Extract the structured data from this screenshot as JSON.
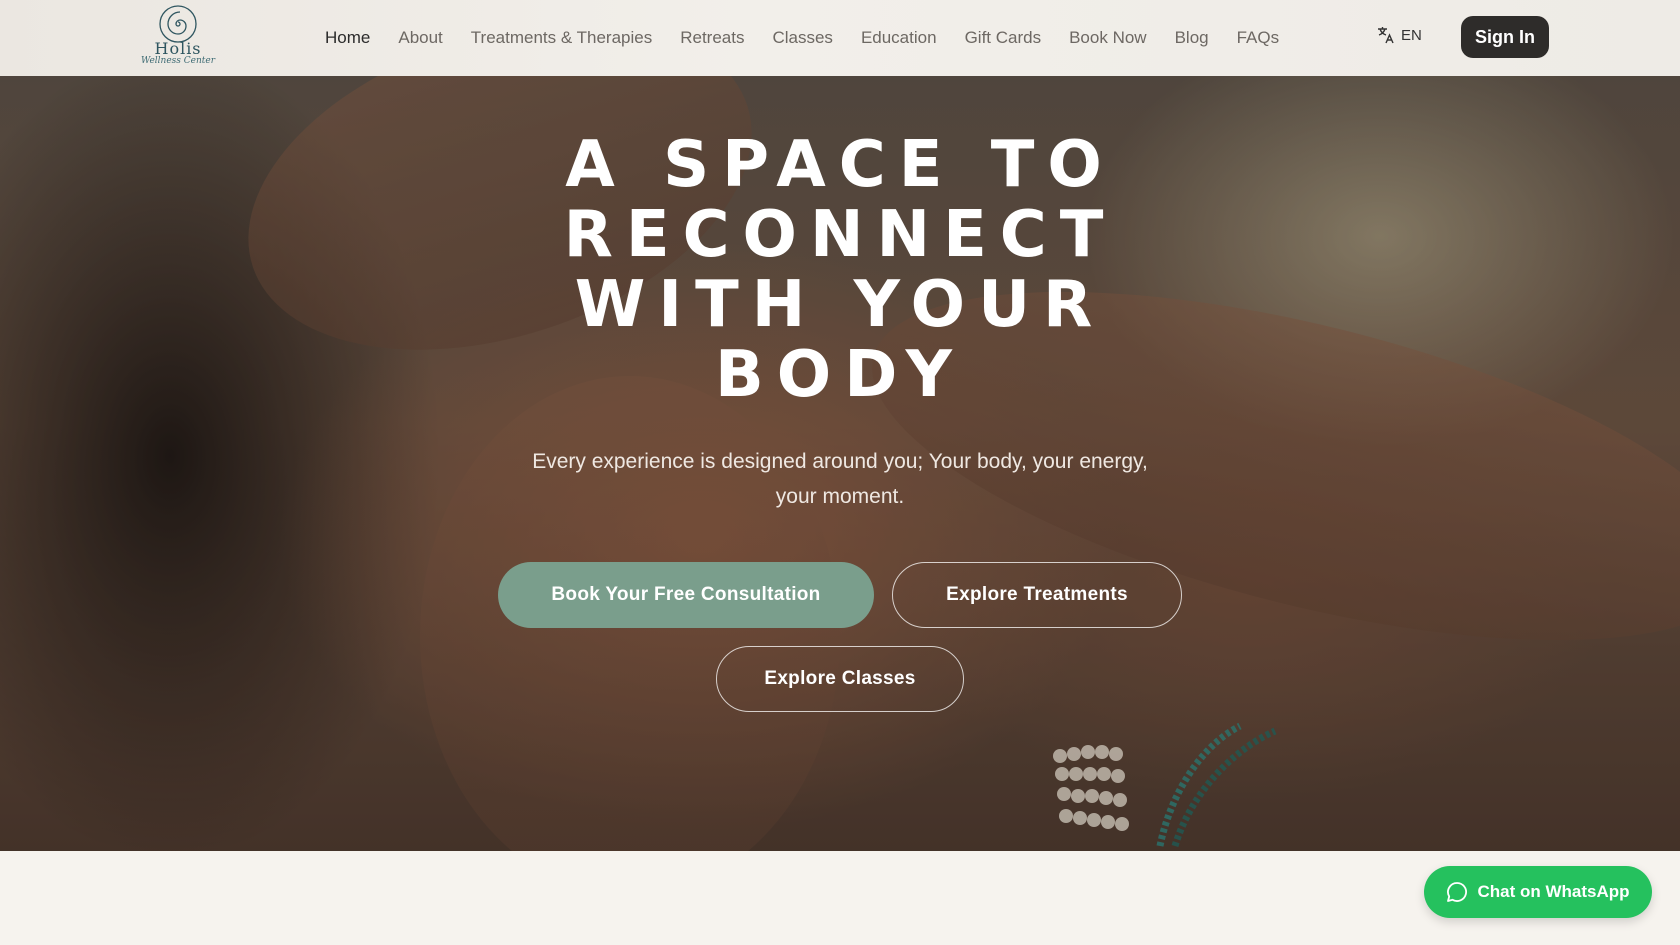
{
  "brand": {
    "name": "Holis",
    "tagline": "Wellness Center"
  },
  "nav": {
    "items": [
      {
        "label": "Home",
        "active": true
      },
      {
        "label": "About"
      },
      {
        "label": "Treatments & Therapies"
      },
      {
        "label": "Retreats"
      },
      {
        "label": "Classes"
      },
      {
        "label": "Education"
      },
      {
        "label": "Gift Cards"
      },
      {
        "label": "Book Now"
      },
      {
        "label": "Blog"
      },
      {
        "label": "FAQs"
      }
    ],
    "language": "EN",
    "signin_label": "Sign In"
  },
  "hero": {
    "title": "A Space to Reconnect with Your Body",
    "subtitle": "Every experience is designed around you; Your body, your energy, your moment.",
    "primary_cta": "Book Your Free Consultation",
    "secondary_cta": "Explore Treatments",
    "tertiary_cta": "Explore Classes"
  },
  "chat": {
    "label": "Chat on WhatsApp",
    "icon": "whatsapp-icon"
  },
  "colors": {
    "accent": "#7a9e8c",
    "dark_button": "#2e2c2a",
    "whatsapp": "#25c15e",
    "page_bg": "#f6f3ee"
  }
}
